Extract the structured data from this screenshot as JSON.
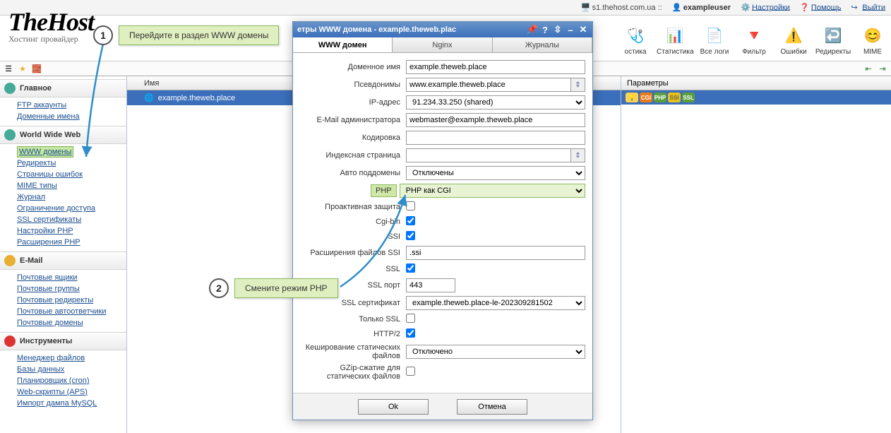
{
  "topbar": {
    "server": "s1.thehost.com.ua ::",
    "user": "exampleuser",
    "settings": "Настройки",
    "help": "Помощь",
    "logout": "Выйти"
  },
  "logo": {
    "title": "TheHost",
    "subtitle": "Хостинг провайдер"
  },
  "toolbar": [
    {
      "label": "остика",
      "icon": "🩺",
      "name": "diagnostics"
    },
    {
      "label": "Статистика",
      "icon": "📊",
      "name": "stats"
    },
    {
      "label": "Все логи",
      "icon": "📄",
      "name": "alllogs"
    },
    {
      "label": "Фильтр",
      "icon": "🔻",
      "name": "filter"
    },
    {
      "label": "Ошибки",
      "icon": "⚠️",
      "name": "errors"
    },
    {
      "label": "Редиректы",
      "icon": "↩️",
      "name": "redirects"
    },
    {
      "label": "MIME",
      "icon": "😊",
      "name": "mime"
    }
  ],
  "sidebar": [
    {
      "title": "Главное",
      "icon": "#4a9",
      "items": [
        "FTP аккаунты",
        "Доменные имена"
      ]
    },
    {
      "title": "World Wide Web",
      "icon": "#4a9",
      "items": [
        "WWW домены",
        "Редиректы",
        "Страницы ошибок",
        "MIME типы",
        "Журнал",
        "Ограничение доступа",
        "SSL сертификаты",
        "Настройки PHP",
        "Расширения PHP"
      ],
      "highlight": 0
    },
    {
      "title": "E-Mail",
      "icon": "#e8b030",
      "items": [
        "Почтовые ящики",
        "Почтовые группы",
        "Почтовые редиректы",
        "Почтовые автоответчики",
        "Почтовые домены"
      ]
    },
    {
      "title": "Инструменты",
      "icon": "#d33",
      "items": [
        "Менеджер файлов",
        "Базы данных",
        "Планировщик (cron)",
        "Web-скрипты (APS)",
        "Импорт дампа MySQL"
      ]
    }
  ],
  "main": {
    "col_name": "Имя",
    "domain": "example.theweb.place"
  },
  "params": {
    "header": "Параметры"
  },
  "dialog": {
    "title": "етры WWW домена - example.theweb.plac",
    "tabs": [
      "WWW домен",
      "Nginx",
      "Журналы"
    ],
    "fields": {
      "domain_label": "Доменное имя",
      "domain_val": "example.theweb.place",
      "alias_label": "Псевдонимы",
      "alias_val": "www.example.theweb.place",
      "ip_label": "IP-адрес",
      "ip_val": "91.234.33.250 (shared)",
      "email_label": "E-Mail администратора",
      "email_val": "webmaster@example.theweb.place",
      "charset_label": "Кодировка",
      "charset_val": "",
      "index_label": "Индексная страница",
      "index_val": "",
      "autosub_label": "Авто поддомены",
      "autosub_val": "Отключены",
      "php_label": "PHP",
      "php_val": "PHP как CGI",
      "proactive_label": "Проактивная защита",
      "cgi_label": "Cgi-bin",
      "ssi_label": "SSI",
      "ssiext_label": "Расширения файлов SSI",
      "ssiext_val": ".ssi",
      "ssl_label": "SSL",
      "sslport_label": "SSL порт",
      "sslport_val": "443",
      "sslcert_label": "SSL сертификат",
      "sslcert_val": "example.theweb.place-le-202309281502",
      "sslonly_label": "Только SSL",
      "http2_label": "HTTP/2",
      "cache_label": "Кеширование статических файлов",
      "cache_val": "Отключено",
      "gzip_label": "GZip-сжатие для статических файлов"
    },
    "ok": "Ok",
    "cancel": "Отмена"
  },
  "annotations": {
    "a1_num": "1",
    "a1_text": "Перейдите в раздел WWW домены",
    "a2_num": "2",
    "a2_text": "Смените режим PHP"
  }
}
